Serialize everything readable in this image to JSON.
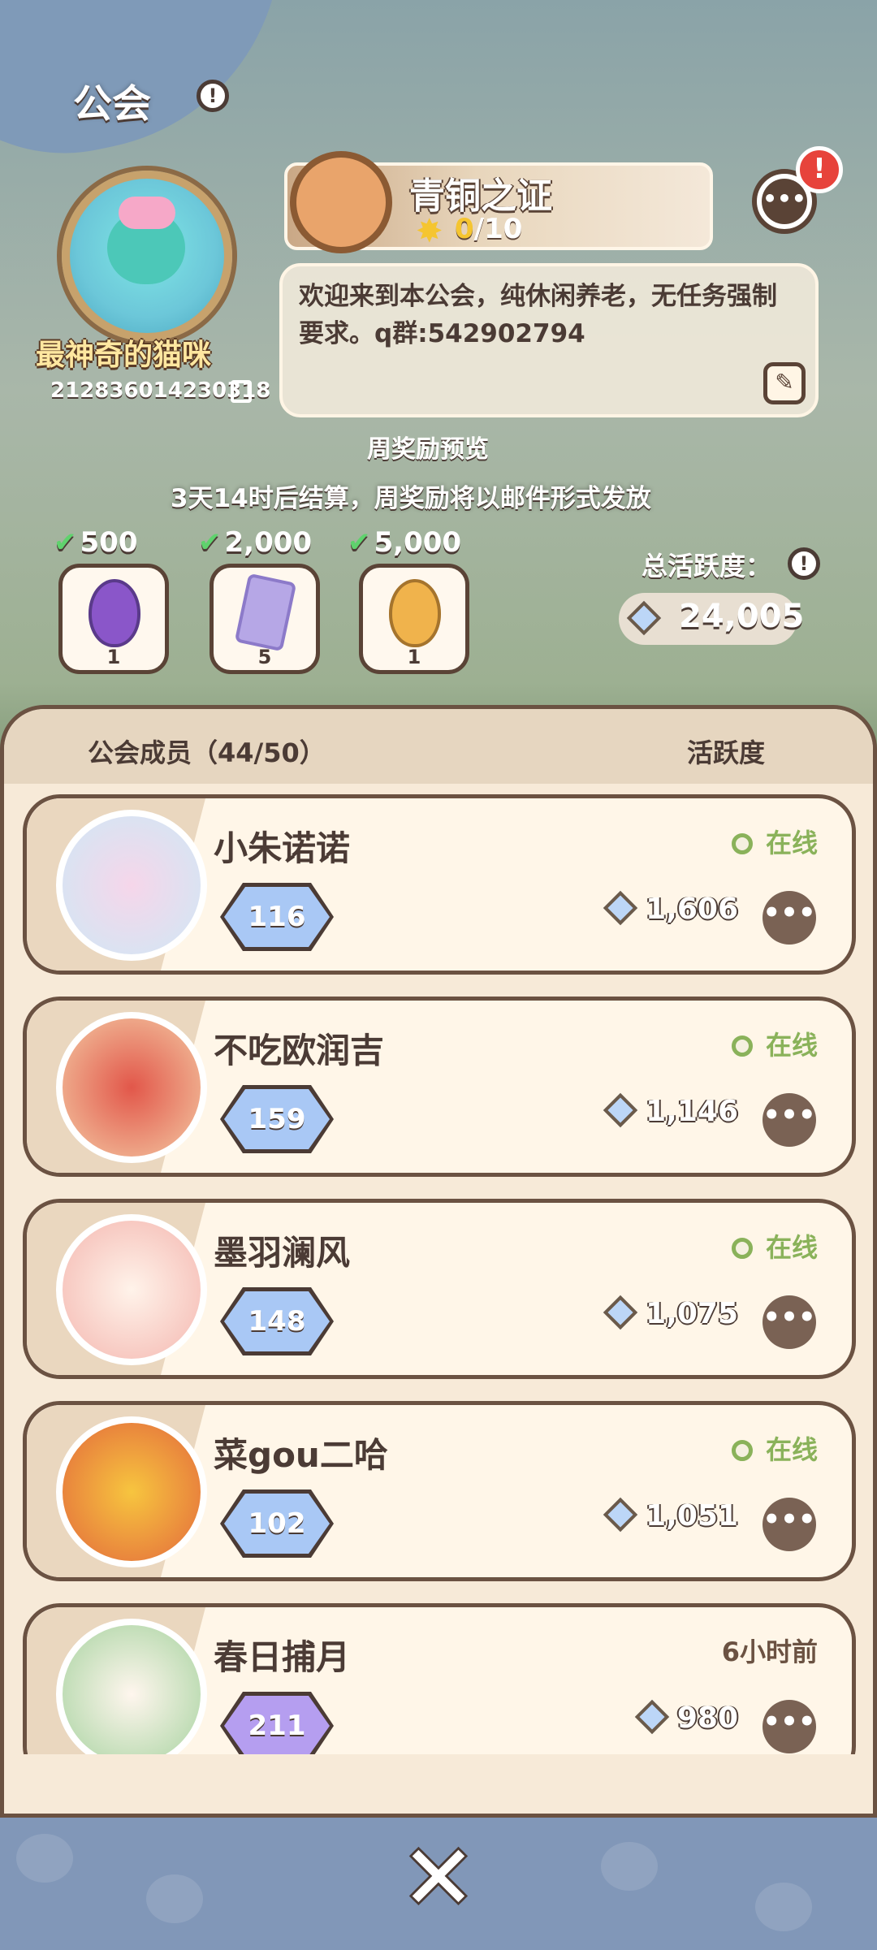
{
  "header": {
    "title": "公会",
    "info_icon": "info-icon"
  },
  "guild": {
    "name": "最神奇的猫咪",
    "id": "212836014230318",
    "emblem_icon": "guild-emblem-icon",
    "copy_icon": "copy-icon"
  },
  "badge": {
    "title": "青铜之证",
    "progress_current": "0",
    "progress_total": "/10"
  },
  "announcement": {
    "text": "欢迎来到本公会，纯休闲养老，无任务强制要求。q群:542902794",
    "edit_icon": "edit-icon"
  },
  "chat": {
    "more_label": "•••",
    "alert": "!"
  },
  "weekly": {
    "title": "周奖励预览",
    "subtitle": "3天14时后结算，周奖励将以邮件形式发放",
    "tiers": [
      {
        "threshold": "500",
        "reward_count": "1",
        "reward": "purple-egg-icon"
      },
      {
        "threshold": "2,000",
        "reward_count": "5",
        "reward": "card-icon"
      },
      {
        "threshold": "5,000",
        "reward_count": "1",
        "reward": "gold-egg-icon"
      }
    ]
  },
  "total_activity": {
    "label": "总活跃度：",
    "value": "24,005"
  },
  "members": {
    "header_label": "公会成员（44/50）",
    "activity_label": "活跃度",
    "items": [
      {
        "name": "小朱诺诺",
        "status": "在线",
        "online": true,
        "level": "116",
        "activity": "1,606"
      },
      {
        "name": "不吃欧润吉",
        "status": "在线",
        "online": true,
        "level": "159",
        "activity": "1,146"
      },
      {
        "name": "墨羽澜风",
        "status": "在线",
        "online": true,
        "level": "148",
        "activity": "1,075"
      },
      {
        "name": "菜gou二哈",
        "status": "在线",
        "online": true,
        "level": "102",
        "activity": "1,051"
      },
      {
        "name": "春日捕月",
        "status": "6小时前",
        "online": false,
        "level": "211",
        "activity": "980"
      }
    ]
  },
  "footer": {
    "close_icon": "close-icon",
    "close_label": "✕"
  },
  "colors": {
    "accent": "#8ab25a",
    "brown": "#4b3b35",
    "panel": "#f7ead8",
    "footer": "#8197b8"
  }
}
